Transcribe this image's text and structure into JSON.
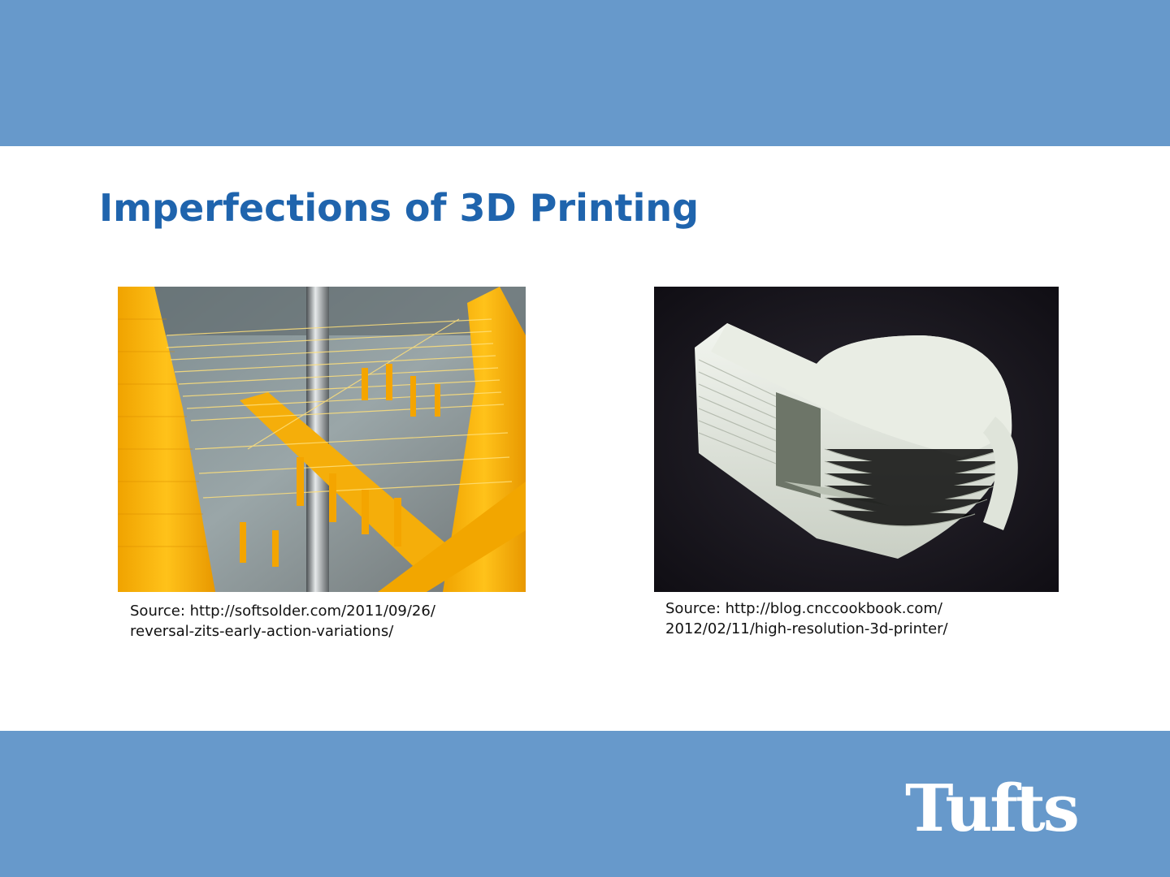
{
  "slide": {
    "title": "Imperfections of 3D Printing",
    "colors": {
      "band": "#6799cb",
      "title": "#1f64ad",
      "logo": "#ffffff"
    }
  },
  "figures": [
    {
      "image": "yellow-3d-print-stringing-photo",
      "caption_lines": [
        "Source: http://softsolder.com/2011/09/26/",
        "reversal-zits-early-action-variations/"
      ]
    },
    {
      "image": "white-3d-printed-whistle-photo",
      "caption_lines": [
        "Source: http://blog.cnccookbook.com/",
        "2012/02/11/high-resolution-3d-printer/"
      ]
    }
  ],
  "footer": {
    "logo_text": "Tufts"
  }
}
